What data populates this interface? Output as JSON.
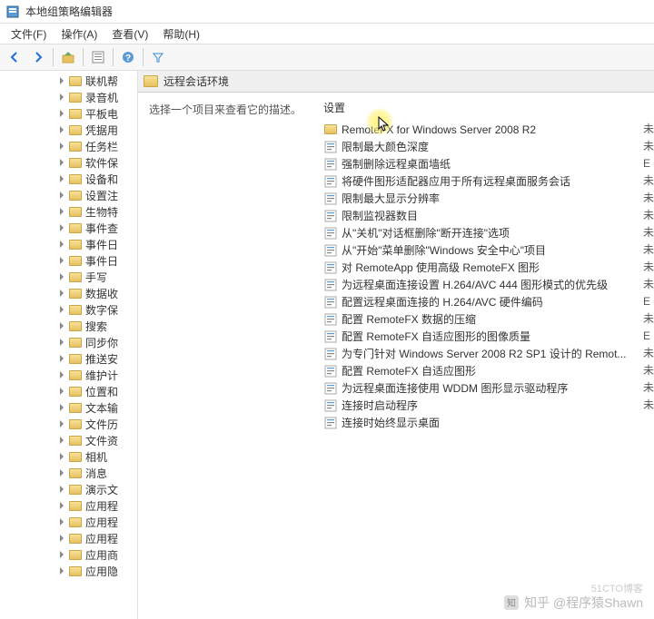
{
  "window": {
    "title": "本地组策略编辑器"
  },
  "menu": {
    "file": "文件(F)",
    "action": "操作(A)",
    "view": "查看(V)",
    "help": "帮助(H)"
  },
  "address": {
    "path": "远程会话环境"
  },
  "desc": {
    "prompt": "选择一个项目来查看它的描述。"
  },
  "list": {
    "header": "设置",
    "items": [
      {
        "type": "folder",
        "label": "RemoteFX for Windows Server 2008 R2"
      },
      {
        "type": "setting",
        "label": "限制最大颜色深度"
      },
      {
        "type": "setting",
        "label": "强制删除远程桌面墙纸"
      },
      {
        "type": "setting",
        "label": "将硬件图形适配器应用于所有远程桌面服务会话"
      },
      {
        "type": "setting",
        "label": "限制最大显示分辨率"
      },
      {
        "type": "setting",
        "label": "限制监视器数目"
      },
      {
        "type": "setting",
        "label": "从\"关机\"对话框删除\"断开连接\"选项"
      },
      {
        "type": "setting",
        "label": "从\"开始\"菜单删除\"Windows 安全中心\"项目"
      },
      {
        "type": "setting",
        "label": "对 RemoteApp 使用高级 RemoteFX 图形"
      },
      {
        "type": "setting",
        "label": "为远程桌面连接设置 H.264/AVC 444 图形模式的优先级"
      },
      {
        "type": "setting",
        "label": "配置远程桌面连接的 H.264/AVC 硬件编码"
      },
      {
        "type": "setting",
        "label": "配置 RemoteFX 数据的压缩"
      },
      {
        "type": "setting",
        "label": "配置 RemoteFX 自适应图形的图像质量"
      },
      {
        "type": "setting",
        "label": "为专门针对 Windows Server 2008 R2 SP1 设计的 Remot..."
      },
      {
        "type": "setting",
        "label": "配置 RemoteFX 自适应图形"
      },
      {
        "type": "setting",
        "label": "为远程桌面连接使用 WDDM 图形显示驱动程序"
      },
      {
        "type": "setting",
        "label": "连接时启动程序"
      },
      {
        "type": "setting",
        "label": "连接时始终显示桌面"
      }
    ]
  },
  "state_hints": [
    "未",
    "未",
    "E",
    "未",
    "未",
    "未",
    "未",
    "未",
    "未",
    "未",
    "E",
    "未",
    "E",
    "未",
    "未",
    "未",
    "未"
  ],
  "tree": {
    "items": [
      "联机帮",
      "录音机",
      "平板电",
      "凭据用",
      "任务栏",
      "软件保",
      "设备和",
      "设置注",
      "生物特",
      "事件查",
      "事件日",
      "事件日",
      "手写",
      "数据收",
      "数字保",
      "搜索",
      "同步你",
      "推送安",
      "维护计",
      "位置和",
      "文本输",
      "文件历",
      "文件资",
      "相机",
      "消息",
      "演示文",
      "应用程",
      "应用程",
      "应用程",
      "应用商",
      "应用隐"
    ]
  },
  "watermark": {
    "top": "知乎 @程序猿Shawn",
    "bottom": "51CTO博客"
  }
}
